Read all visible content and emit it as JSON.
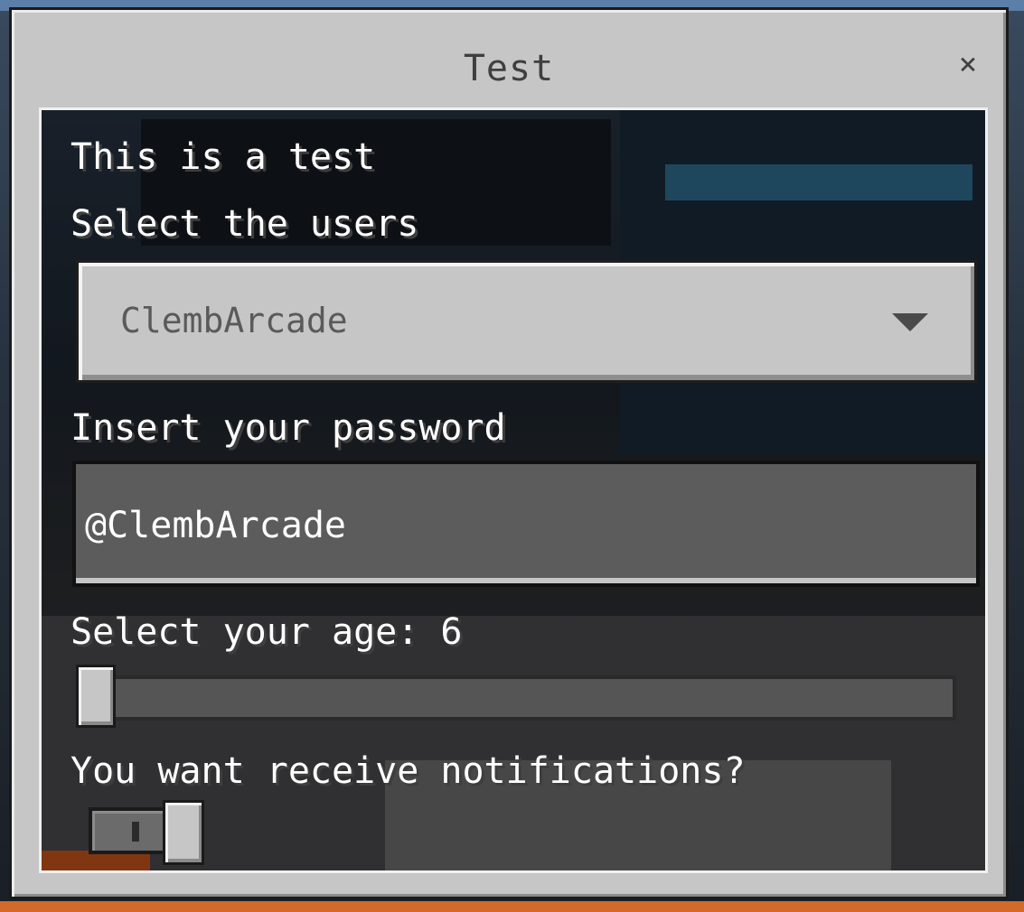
{
  "dialog": {
    "title": "Test",
    "close_icon": "close-icon",
    "close_glyph": "×"
  },
  "form": {
    "intro_label": "This is a test",
    "users_label": "Select the users",
    "users_dropdown": {
      "selected": "ClembArcade",
      "icon": "chevron-down-icon"
    },
    "password_label": "Insert your password",
    "password_input": {
      "value": "@ClembArcade"
    },
    "age_label": "Select your age: 6",
    "age_slider": {
      "value": 6,
      "fraction": 0.0
    },
    "notifications_label": "You want receive notifications?",
    "notifications_toggle": {
      "state": "off",
      "icon": "toggle-switch"
    }
  }
}
